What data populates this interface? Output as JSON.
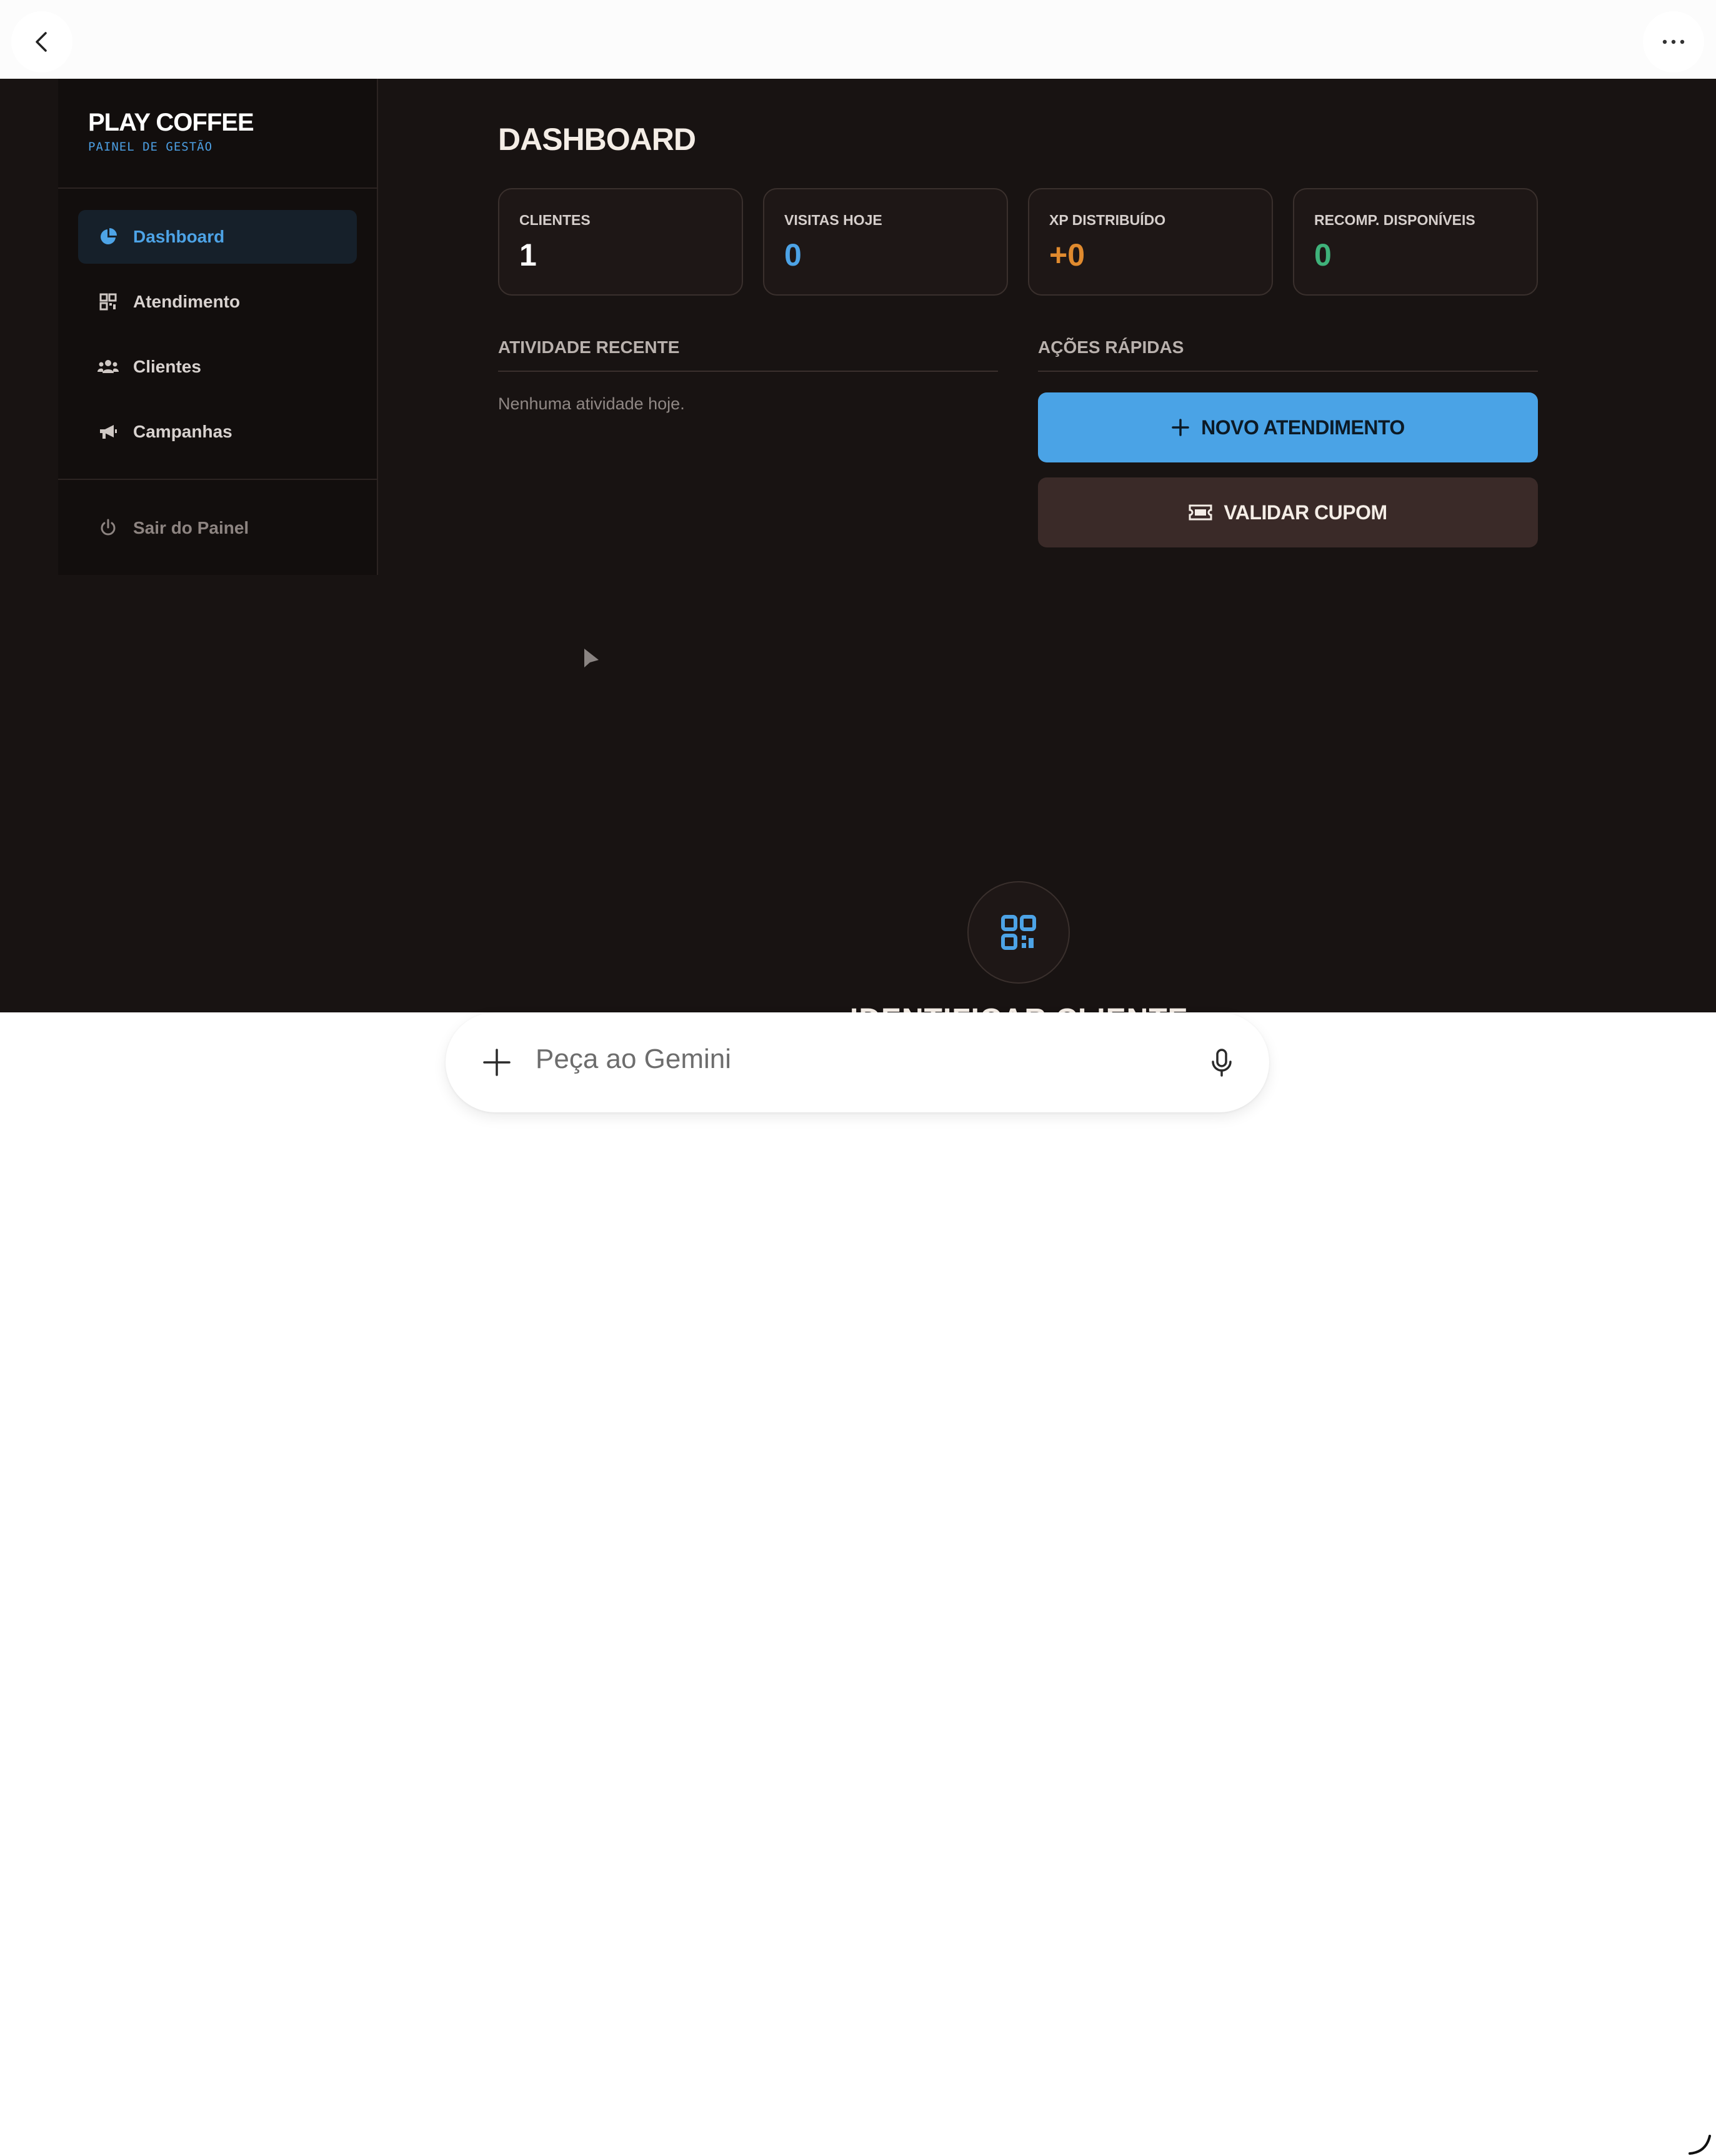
{
  "brand": {
    "title": "PLAY COFFEE",
    "subtitle": "PAINEL DE GESTÃO"
  },
  "sidebar": {
    "items": [
      {
        "label": "Dashboard",
        "icon": "pie-chart-icon",
        "active": true
      },
      {
        "label": "Atendimento",
        "icon": "qr-code-icon",
        "active": false
      },
      {
        "label": "Clientes",
        "icon": "users-icon",
        "active": false
      },
      {
        "label": "Campanhas",
        "icon": "megaphone-icon",
        "active": false
      }
    ],
    "logout_label": "Sair do Painel"
  },
  "main": {
    "title": "DASHBOARD",
    "stats": [
      {
        "label": "CLIENTES",
        "value": "1",
        "color": "#ffffff"
      },
      {
        "label": "VISITAS HOJE",
        "value": "0",
        "color": "#4da3e6"
      },
      {
        "label": "XP DISTRIBUÍDO",
        "value": "+0",
        "color": "#e08a2e"
      },
      {
        "label": "RECOMP. DISPONÍVEIS",
        "value": "0",
        "color": "#3fb27a"
      }
    ],
    "recent_activity": {
      "title": "ATIVIDADE RECENTE",
      "empty_text": "Nenhuma atividade hoje."
    },
    "quick_actions": {
      "title": "AÇÕES RÁPIDAS",
      "new_service_label": "NOVO ATENDIMENTO",
      "validate_coupon_label": "VALIDAR CUPOM"
    },
    "identify_client_peek": "IDENTIFICAR CLIENTE"
  },
  "gemini": {
    "placeholder": "Peça ao Gemini"
  },
  "colors": {
    "accent": "#4aa3e6",
    "app_background": "#181312",
    "sidebar_background": "#120e0d"
  }
}
